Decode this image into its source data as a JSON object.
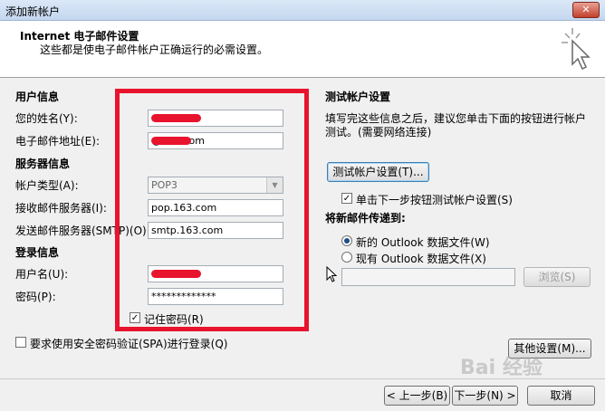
{
  "window": {
    "title": "添加新帐户",
    "close_label": "✕"
  },
  "header": {
    "title": "Internet 电子邮件设置",
    "subtitle": "这些都是使电子邮件帐户正确运行的必需设置。"
  },
  "user_info": {
    "section": "用户信息",
    "name_label": "您的姓名(Y):",
    "email_label": "电子邮件地址(E):",
    "email_value": "         @163.com"
  },
  "server_info": {
    "section": "服务器信息",
    "account_type_label": "帐户类型(A):",
    "account_type_value": "POP3",
    "incoming_label": "接收邮件服务器(I):",
    "incoming_value": "pop.163.com",
    "outgoing_label": "发送邮件服务器(SMTP)(O):",
    "outgoing_value": "smtp.163.com"
  },
  "login_info": {
    "section": "登录信息",
    "username_label": "用户名(U):",
    "password_label": "密码(P):",
    "password_value": "*************",
    "remember_label": "记住密码(R)",
    "remember_checked": true
  },
  "spa": {
    "label": "要求使用安全密码验证(SPA)进行登录(Q)",
    "checked": false
  },
  "test": {
    "section": "测试帐户设置",
    "desc_line1": "填写完这些信息之后，建议您单击下面的按钮进行帐户",
    "desc_line2": "测试。(需要网络连接)",
    "button": "测试帐户设置(T)...",
    "auto_label": "单击下一步按钮测试帐户设置(S)",
    "auto_checked": true
  },
  "deliver": {
    "section": "将新邮件传递到:",
    "option_new": "新的 Outlook 数据文件(W)",
    "option_existing": "现有 Outlook 数据文件(X)",
    "browse": "浏览(S)"
  },
  "buttons": {
    "more": "其他设置(M)...",
    "back": "< 上一步(B)",
    "next": "下一步(N) >",
    "cancel": "取消"
  },
  "watermark": "Bai 经验"
}
